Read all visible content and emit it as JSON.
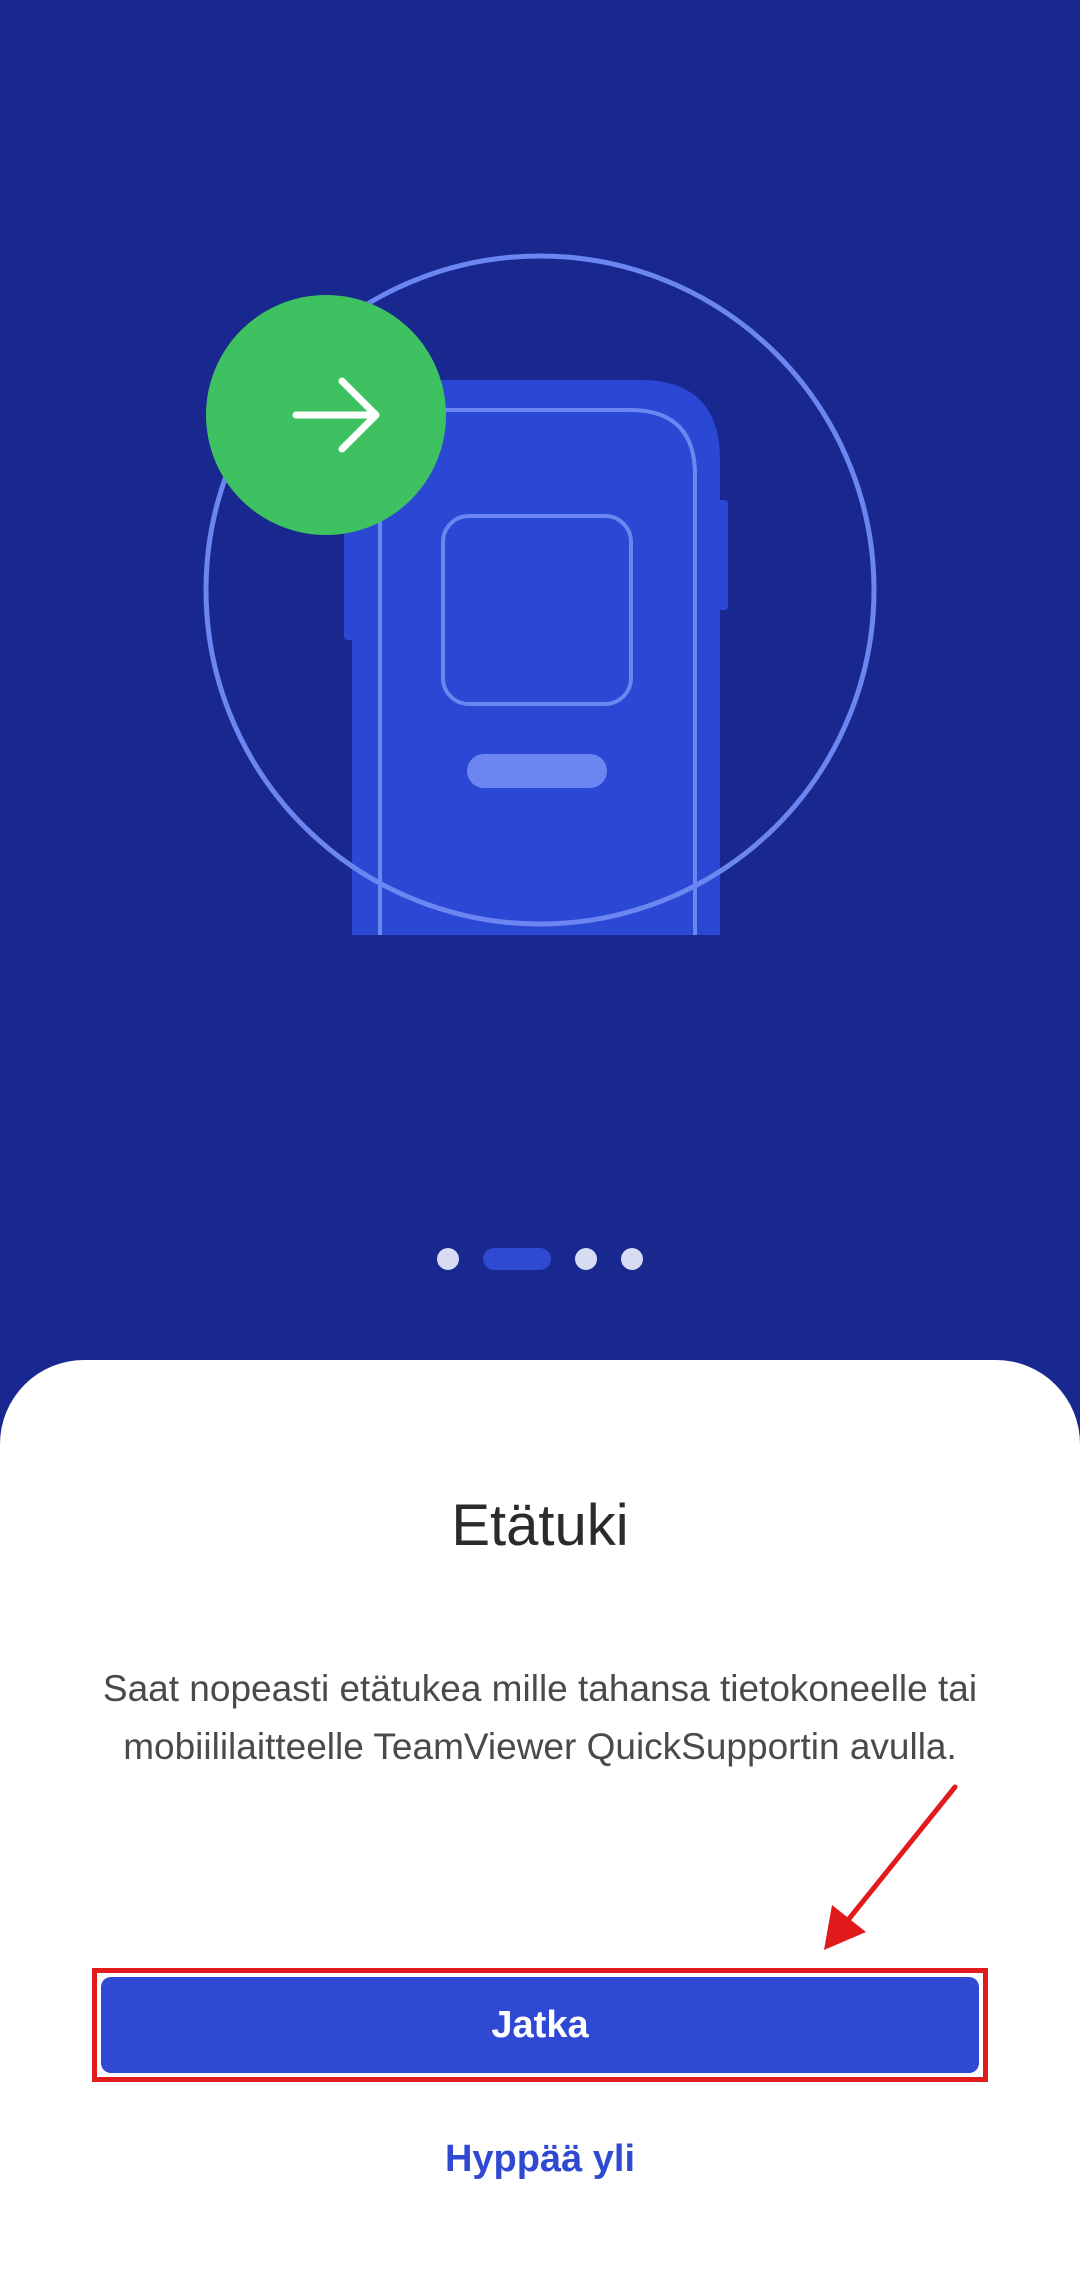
{
  "hero": {
    "pager": {
      "total": 4,
      "active_index": 1
    },
    "colors": {
      "background": "#19288f",
      "phone": "#2a48d4",
      "circle_outline": "#6b86f0",
      "badge": "#3ec160"
    },
    "icons": {
      "badge": "arrow-right-icon"
    }
  },
  "sheet": {
    "title": "Etätuki",
    "description": "Saat nopeasti etätukea mille tahansa tietokoneelle tai mobiililaitteelle TeamViewer QuickSupportin avulla.",
    "continue_label": "Jatka",
    "skip_label": "Hyppää yli"
  },
  "annotation": {
    "highlight_color": "#e11b1b"
  }
}
